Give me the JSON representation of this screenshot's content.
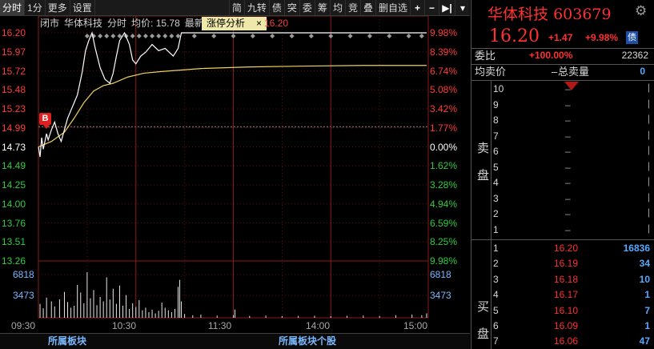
{
  "toolbar": {
    "left_items": [
      "分时",
      "1分",
      "更多",
      "设置"
    ],
    "right_items": [
      "简",
      "九转",
      "债",
      "突",
      "委",
      "筹",
      "均",
      "竞",
      "叠",
      "删自选"
    ],
    "icons": [
      "plus-icon",
      "minus-icon",
      "forward-step-icon",
      "dropdown-icon"
    ]
  },
  "info_bar": {
    "status": "闭市",
    "name": "华体科技",
    "mode": "分时",
    "avg_label": "均价:",
    "avg_value": "15.78",
    "latest_label": "最新",
    "zt_label": "涨停分析",
    "zt_close": "×",
    "latest_value": "16.20"
  },
  "price_axis": {
    "left": [
      "16.20",
      "15.97",
      "15.72",
      "15.48",
      "15.23",
      "14.99",
      "14.73",
      "14.49",
      "14.25",
      "14.00",
      "13.76",
      "13.51",
      "13.26"
    ],
    "right": [
      "9.98%",
      "8.39%",
      "6.74%",
      "5.08%",
      "3.42%",
      "1.77%",
      "0.00%",
      "1.62%",
      "3.28%",
      "4.94%",
      "6.59%",
      "8.25%",
      "9.98%"
    ],
    "colors": [
      "#ff3b3b",
      "#ff3b3b",
      "#ff3b3b",
      "#ff3b3b",
      "#ff3b3b",
      "#ff3b3b",
      "#ffffff",
      "#2ecc40",
      "#2ecc40",
      "#2ecc40",
      "#2ecc40",
      "#2ecc40",
      "#2ecc40"
    ]
  },
  "volume_axis": {
    "left": [
      "6818",
      "3473"
    ],
    "right": [
      "6818",
      "3473"
    ]
  },
  "time_axis": [
    "09:30",
    "10:30",
    "11:30",
    "14:00",
    "15:00"
  ],
  "b_marker": "B",
  "bottom_bar": {
    "tab1": "所属板块",
    "tab2": "所属板块个股"
  },
  "chart_data": {
    "type": "line",
    "ylim": [
      13.26,
      16.2
    ],
    "prev_close": 14.73,
    "series": [],
    "price_points": [
      [
        0,
        14.73
      ],
      [
        1,
        14.6
      ],
      [
        2,
        14.85
      ],
      [
        3,
        14.7
      ],
      [
        5,
        14.9
      ],
      [
        6,
        14.82
      ],
      [
        8,
        14.95
      ],
      [
        10,
        15.05
      ],
      [
        12,
        14.9
      ],
      [
        14,
        14.8
      ],
      [
        16,
        14.95
      ],
      [
        18,
        15.1
      ],
      [
        20,
        15.2
      ],
      [
        24,
        15.4
      ],
      [
        27,
        15.7
      ],
      [
        29,
        15.97
      ],
      [
        31,
        16.1
      ],
      [
        33,
        16.2
      ],
      [
        35,
        16.0
      ],
      [
        38,
        15.75
      ],
      [
        41,
        15.6
      ],
      [
        44,
        15.55
      ],
      [
        46,
        15.68
      ],
      [
        48,
        15.9
      ],
      [
        50,
        16.1
      ],
      [
        53,
        16.2
      ],
      [
        56,
        16.05
      ],
      [
        58,
        15.85
      ],
      [
        60,
        15.8
      ],
      [
        63,
        15.9
      ],
      [
        66,
        15.95
      ],
      [
        70,
        16.05
      ],
      [
        74,
        15.97
      ],
      [
        78,
        16.0
      ],
      [
        83,
        15.9
      ],
      [
        86,
        16.0
      ],
      [
        88,
        16.2
      ],
      [
        239,
        16.2
      ]
    ],
    "avg_points": [
      [
        0,
        14.73
      ],
      [
        8,
        14.8
      ],
      [
        16,
        14.92
      ],
      [
        22,
        15.1
      ],
      [
        28,
        15.3
      ],
      [
        34,
        15.45
      ],
      [
        40,
        15.52
      ],
      [
        46,
        15.55
      ],
      [
        55,
        15.63
      ],
      [
        65,
        15.68
      ],
      [
        75,
        15.7
      ],
      [
        88,
        15.72
      ],
      [
        100,
        15.74
      ],
      [
        130,
        15.76
      ],
      [
        160,
        15.77
      ],
      [
        200,
        15.78
      ],
      [
        239,
        15.78
      ]
    ],
    "volume_max": 9000,
    "volume_points": [
      [
        1,
        2200
      ],
      [
        3,
        1500
      ],
      [
        5,
        3200
      ],
      [
        8,
        2600
      ],
      [
        10,
        1800
      ],
      [
        13,
        2900
      ],
      [
        16,
        4100
      ],
      [
        18,
        2500
      ],
      [
        20,
        1600
      ],
      [
        22,
        1900
      ],
      [
        24,
        5200
      ],
      [
        26,
        4000
      ],
      [
        28,
        2300
      ],
      [
        30,
        7200
      ],
      [
        32,
        3100
      ],
      [
        34,
        4400
      ],
      [
        36,
        2000
      ],
      [
        38,
        3300
      ],
      [
        40,
        2600
      ],
      [
        42,
        6400
      ],
      [
        44,
        2900
      ],
      [
        46,
        4600
      ],
      [
        48,
        2200
      ],
      [
        50,
        5100
      ],
      [
        52,
        1900
      ],
      [
        54,
        3600
      ],
      [
        56,
        1400
      ],
      [
        58,
        2300
      ],
      [
        60,
        1700
      ],
      [
        62,
        2800
      ],
      [
        64,
        1200
      ],
      [
        66,
        1600
      ],
      [
        68,
        900
      ],
      [
        70,
        1300
      ],
      [
        72,
        700
      ],
      [
        74,
        1100
      ],
      [
        76,
        2400
      ],
      [
        78,
        1600
      ],
      [
        80,
        1200
      ],
      [
        82,
        900
      ],
      [
        84,
        1400
      ],
      [
        86,
        4900
      ],
      [
        87,
        6000
      ],
      [
        88,
        2600
      ],
      [
        90,
        600
      ],
      [
        95,
        400
      ],
      [
        100,
        500
      ],
      [
        110,
        350
      ],
      [
        120,
        420
      ],
      [
        121,
        1300
      ],
      [
        130,
        300
      ],
      [
        140,
        350
      ],
      [
        150,
        280
      ],
      [
        160,
        300
      ],
      [
        170,
        320
      ],
      [
        180,
        260
      ],
      [
        190,
        300
      ],
      [
        200,
        350
      ],
      [
        210,
        300
      ],
      [
        220,
        420
      ],
      [
        230,
        500
      ],
      [
        236,
        400
      ],
      [
        239,
        700
      ]
    ],
    "diamond_times": [
      30,
      34,
      38,
      42,
      46,
      50,
      54,
      58,
      62,
      66,
      70,
      74,
      78,
      82,
      86,
      96,
      108,
      120,
      132,
      144,
      156,
      168,
      180,
      192,
      204,
      216,
      228,
      236
    ]
  },
  "panel": {
    "name": "华体科技",
    "code": "603679",
    "price": "16.20",
    "change": "+1.47",
    "change_pct": "+9.98%",
    "badge": "债",
    "wb_label": "委比",
    "wb_pct": "+100.00%",
    "wb_num": "22362",
    "jmj_label": "均卖价",
    "jmj_val": "–",
    "zml_label": "总卖量",
    "zml_val": "0",
    "sell_side_label": [
      "卖",
      "盘"
    ],
    "buy_side_label": [
      "买",
      "盘"
    ],
    "sell_levels": [
      {
        "lvl": "10",
        "price": "–",
        "vol": "|"
      },
      {
        "lvl": "9",
        "price": "–",
        "vol": "|"
      },
      {
        "lvl": "8",
        "price": "–",
        "vol": "|"
      },
      {
        "lvl": "7",
        "price": "–",
        "vol": "|"
      },
      {
        "lvl": "6",
        "price": "–",
        "vol": "|"
      },
      {
        "lvl": "5",
        "price": "–",
        "vol": "|"
      },
      {
        "lvl": "4",
        "price": "–",
        "vol": "|"
      },
      {
        "lvl": "3",
        "price": "–",
        "vol": "|"
      },
      {
        "lvl": "2",
        "price": "–",
        "vol": "|"
      },
      {
        "lvl": "1",
        "price": "–",
        "vol": "|"
      }
    ],
    "buy_levels": [
      {
        "lvl": "1",
        "price": "16.20",
        "vol": "16836"
      },
      {
        "lvl": "2",
        "price": "16.19",
        "vol": "34"
      },
      {
        "lvl": "3",
        "price": "16.18",
        "vol": "10"
      },
      {
        "lvl": "4",
        "price": "16.17",
        "vol": "1"
      },
      {
        "lvl": "5",
        "price": "16.10",
        "vol": "7"
      },
      {
        "lvl": "6",
        "price": "16.09",
        "vol": "1"
      },
      {
        "lvl": "7",
        "price": "16.06",
        "vol": "47"
      }
    ],
    "price_color_red": "#ff3030",
    "vol_color_blue": "#58a8ff"
  }
}
